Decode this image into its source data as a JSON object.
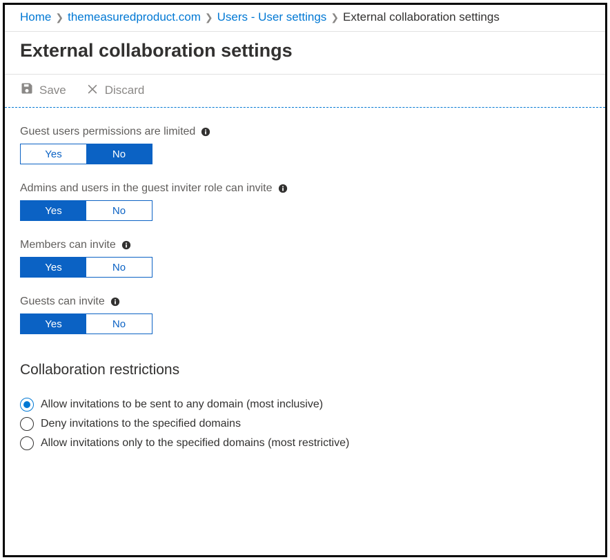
{
  "breadcrumb": {
    "items": [
      {
        "label": "Home",
        "link": true
      },
      {
        "label": "themeasuredproduct.com",
        "link": true
      },
      {
        "label": "Users - User settings",
        "link": true
      },
      {
        "label": "External collaboration settings",
        "link": false
      }
    ]
  },
  "page": {
    "title": "External collaboration settings"
  },
  "toolbar": {
    "save_label": "Save",
    "discard_label": "Discard"
  },
  "settings": [
    {
      "label": "Guest users permissions are limited",
      "yes": "Yes",
      "no": "No",
      "value": "No"
    },
    {
      "label": "Admins and users in the guest inviter role can invite",
      "yes": "Yes",
      "no": "No",
      "value": "Yes"
    },
    {
      "label": "Members can invite",
      "yes": "Yes",
      "no": "No",
      "value": "Yes"
    },
    {
      "label": "Guests can invite",
      "yes": "Yes",
      "no": "No",
      "value": "Yes"
    }
  ],
  "restrictions": {
    "heading": "Collaboration restrictions",
    "options": [
      {
        "label": "Allow invitations to be sent to any domain (most inclusive)",
        "checked": true
      },
      {
        "label": "Deny invitations to the specified domains",
        "checked": false
      },
      {
        "label": "Allow invitations only to the specified domains (most restrictive)",
        "checked": false
      }
    ]
  }
}
